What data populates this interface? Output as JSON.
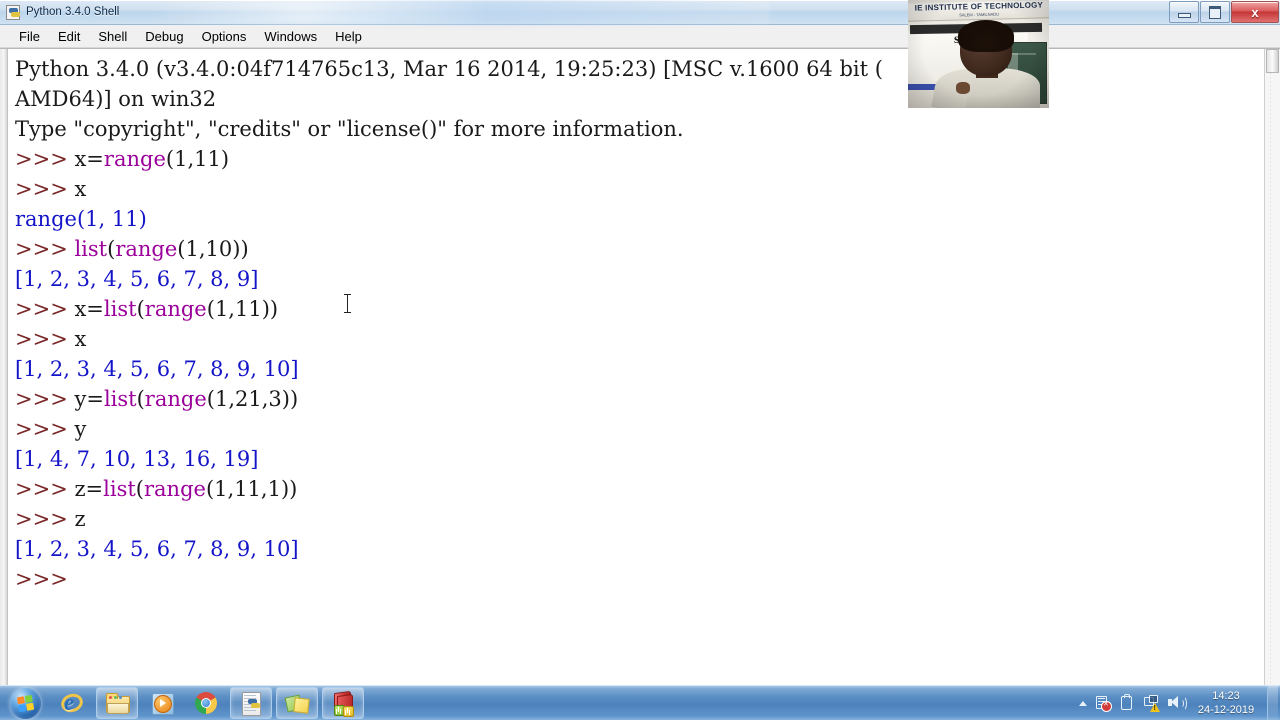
{
  "window": {
    "title": "Python 3.4.0 Shell",
    "icon": "python-idle-icon",
    "controls": {
      "minimize": "minimize-button",
      "maximize": "maximize-button",
      "close_label": "x"
    }
  },
  "menubar": {
    "items": [
      {
        "label": "File"
      },
      {
        "label": "Edit"
      },
      {
        "label": "Shell"
      },
      {
        "label": "Debug"
      },
      {
        "label": "Options"
      },
      {
        "label": "Windows"
      },
      {
        "label": "Help"
      }
    ]
  },
  "shell": {
    "lines": [
      [
        {
          "text": "Python 3.4.0 (v3.4.0:04f714765c13, Mar 16 2014, 19:25:23) [MSC v.1600 64 bit (",
          "style": "normal"
        }
      ],
      [
        {
          "text": "AMD64)] on win32",
          "style": "normal"
        }
      ],
      [
        {
          "text": "Type \"copyright\", \"credits\" or \"license()\" for more information.",
          "style": "normal"
        }
      ],
      [
        {
          "text": ">>> ",
          "style": "prompt"
        },
        {
          "text": "x=",
          "style": "normal"
        },
        {
          "text": "range",
          "style": "builtin"
        },
        {
          "text": "(1,11)",
          "style": "normal"
        }
      ],
      [
        {
          "text": ">>> ",
          "style": "prompt"
        },
        {
          "text": "x",
          "style": "normal"
        }
      ],
      [
        {
          "text": "range(1, 11)",
          "style": "output"
        }
      ],
      [
        {
          "text": ">>> ",
          "style": "prompt"
        },
        {
          "text": "list",
          "style": "builtin"
        },
        {
          "text": "(",
          "style": "normal"
        },
        {
          "text": "range",
          "style": "builtin"
        },
        {
          "text": "(1,10))",
          "style": "normal"
        }
      ],
      [
        {
          "text": "[1, 2, 3, 4, 5, 6, 7, 8, 9]",
          "style": "output"
        }
      ],
      [
        {
          "text": ">>> ",
          "style": "prompt"
        },
        {
          "text": "x=",
          "style": "normal"
        },
        {
          "text": "list",
          "style": "builtin"
        },
        {
          "text": "(",
          "style": "normal"
        },
        {
          "text": "range",
          "style": "builtin"
        },
        {
          "text": "(1,11))",
          "style": "normal"
        }
      ],
      [
        {
          "text": ">>> ",
          "style": "prompt"
        },
        {
          "text": "x",
          "style": "normal"
        }
      ],
      [
        {
          "text": "[1, 2, 3, 4, 5, 6, 7, 8, 9, 10]",
          "style": "output"
        }
      ],
      [
        {
          "text": ">>> ",
          "style": "prompt"
        },
        {
          "text": "y=",
          "style": "normal"
        },
        {
          "text": "list",
          "style": "builtin"
        },
        {
          "text": "(",
          "style": "normal"
        },
        {
          "text": "range",
          "style": "builtin"
        },
        {
          "text": "(1,21,3))",
          "style": "normal"
        }
      ],
      [
        {
          "text": ">>> ",
          "style": "prompt"
        },
        {
          "text": "y",
          "style": "normal"
        }
      ],
      [
        {
          "text": "[1, 4, 7, 10, 13, 16, 19]",
          "style": "output"
        }
      ],
      [
        {
          "text": ">>> ",
          "style": "prompt"
        },
        {
          "text": "z=",
          "style": "normal"
        },
        {
          "text": "list",
          "style": "builtin"
        },
        {
          "text": "(",
          "style": "normal"
        },
        {
          "text": "range",
          "style": "builtin"
        },
        {
          "text": "(1,11,1))",
          "style": "normal"
        }
      ],
      [
        {
          "text": ">>> ",
          "style": "prompt"
        },
        {
          "text": "z",
          "style": "normal"
        }
      ],
      [
        {
          "text": "[1, 2, 3, 4, 5, 6, 7, 8, 9, 10]",
          "style": "output"
        }
      ],
      [
        {
          "text": ">>>",
          "style": "prompt"
        }
      ]
    ],
    "colors": {
      "prompt": "#7a2828",
      "builtin": "#9b009b",
      "output": "#1414c8",
      "normal": "#1a1a1a",
      "background": "#ffffff"
    }
  },
  "webcam": {
    "banner_line1": "IE INSTITUTE OF TECHNOLOGY",
    "banner_line2": "SALEM - TAMILNADU",
    "letter_overlay": "s"
  },
  "taskbar": {
    "start": "start-orb",
    "items": [
      {
        "name": "internet-explorer",
        "label": "Internet Explorer",
        "boxed": false
      },
      {
        "name": "windows-explorer",
        "label": "Windows Explorer",
        "boxed": true
      },
      {
        "name": "windows-media-player",
        "label": "Windows Media Player",
        "boxed": false
      },
      {
        "name": "google-chrome",
        "label": "Google Chrome",
        "boxed": false
      },
      {
        "name": "python-idle",
        "label": "Python 3.4.0 Shell",
        "boxed": true
      },
      {
        "name": "sticky-notes",
        "label": "Notes",
        "boxed": true
      },
      {
        "name": "dictionary",
        "label": "Dictionary",
        "boxed": true
      }
    ],
    "tray": {
      "show_hidden": "show-hidden-icons",
      "icons": [
        {
          "name": "action-center-icon",
          "label": "Action Center"
        },
        {
          "name": "safely-remove-hardware-icon",
          "label": "Safely Remove Hardware"
        },
        {
          "name": "network-icon",
          "label": "Network"
        },
        {
          "name": "volume-icon",
          "label": "Volume"
        }
      ]
    },
    "clock": {
      "time": "14:23",
      "date": "24-12-2019"
    }
  }
}
